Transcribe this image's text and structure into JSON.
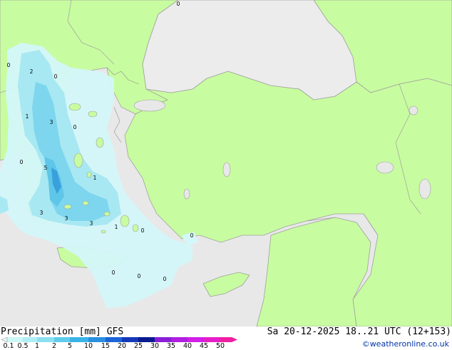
{
  "footer": {
    "title": "Precipitation [mm]",
    "model": "GFS",
    "valid": "Sa 20-12-2025 18..21 UTC (12+153)",
    "credit": "©weatheronline.co.uk"
  },
  "legend": {
    "ticks": [
      "0.1",
      "0.5",
      "1",
      "2",
      "5",
      "10",
      "15",
      "20",
      "25",
      "30",
      "35",
      "40",
      "45",
      "50"
    ],
    "colors": [
      "#ccf7f7",
      "#b0eef5",
      "#8ce0f0",
      "#5ecdeb",
      "#3ab4e6",
      "#2a8fe0",
      "#1c64d8",
      "#1438b8",
      "#0a1a90",
      "#8a1ed8",
      "#b01ee0",
      "#d21ee8",
      "#e61ec8",
      "#f01ea0"
    ]
  },
  "colors": {
    "land": "#c8fca0",
    "sea": "#e8e8e8",
    "precip_light": "#d4f7f9",
    "precip_mid": "#a8e8f2",
    "precip_heavy": "#5ec6e8",
    "precip_max": "#3aa0dc",
    "border": "#a0a0a0"
  },
  "map_labels": [
    {
      "text": "0"
    },
    {
      "text": "0"
    },
    {
      "text": "2"
    },
    {
      "text": "0"
    },
    {
      "text": "1"
    },
    {
      "text": "3"
    },
    {
      "text": "0"
    },
    {
      "text": "0"
    },
    {
      "text": "5"
    },
    {
      "text": "1"
    },
    {
      "text": "3"
    },
    {
      "text": "3"
    },
    {
      "text": "3"
    },
    {
      "text": "1"
    },
    {
      "text": "0"
    },
    {
      "text": "0"
    },
    {
      "text": "0"
    },
    {
      "text": "0"
    },
    {
      "text": "0"
    }
  ]
}
